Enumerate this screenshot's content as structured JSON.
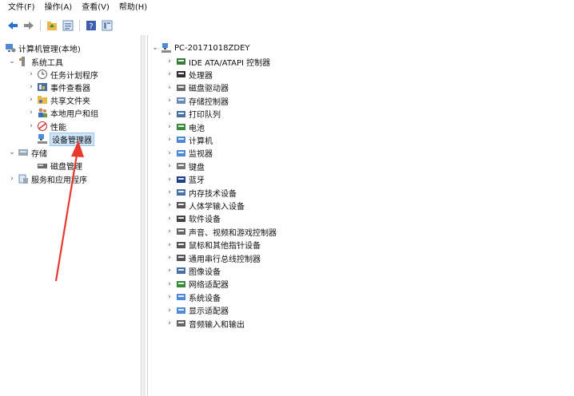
{
  "menu": [
    "文件(F)",
    "操作(A)",
    "查看(V)",
    "帮助(H)"
  ],
  "toolbar": {
    "icons": [
      "back-arrow-icon",
      "forward-arrow-icon",
      "up-folder-icon",
      "properties-icon",
      "help-icon",
      "show-hide-tree-icon"
    ]
  },
  "left_tree": {
    "root": "计算机管理(本地)",
    "system_tools": "系统工具",
    "task_scheduler": "任务计划程序",
    "event_viewer": "事件查看器",
    "shared_folders": "共享文件夹",
    "local_users": "本地用户和组",
    "performance": "性能",
    "device_manager": "设备管理器",
    "storage": "存储",
    "disk_management": "磁盘管理",
    "services": "服务和应用程序"
  },
  "right_tree": {
    "computer": "PC-20171018ZDEY",
    "items": [
      "IDE ATA/ATAPI 控制器",
      "处理器",
      "磁盘驱动器",
      "存储控制器",
      "打印队列",
      "电池",
      "计算机",
      "监视器",
      "键盘",
      "蓝牙",
      "内存技术设备",
      "人体学输入设备",
      "软件设备",
      "声音、视频和游戏控制器",
      "鼠标和其他指针设备",
      "通用串行总线控制器",
      "图像设备",
      "网络适配器",
      "系统设备",
      "显示适配器",
      "音频输入和输出"
    ]
  },
  "colors": {
    "accent": "#e8392f",
    "selection": "#cfe5fb"
  }
}
